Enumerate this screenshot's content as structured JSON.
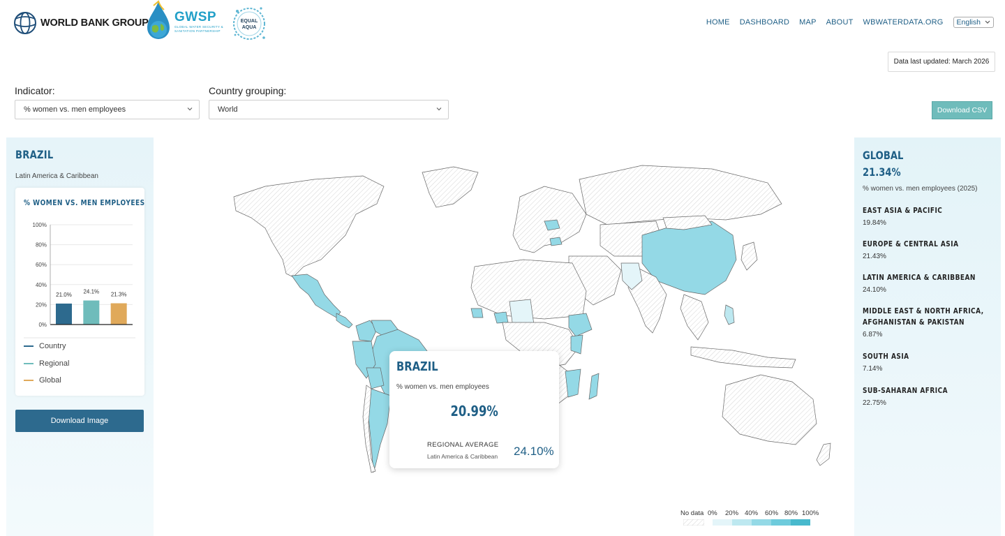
{
  "header": {
    "wb_logo_text": "WORLD BANK GROUP",
    "gwsp_title": "GWSP",
    "gwsp_subtitle": "GLOBAL WATER SECURITY & SANITATION PARTNERSHIP",
    "equal_aqua_text": "EQUAL AQUA",
    "nav": [
      "HOME",
      "DASHBOARD",
      "MAP",
      "ABOUT",
      "WBWATERDATA.ORG"
    ],
    "language": "English",
    "data_updated": "Data last updated: March 2026"
  },
  "controls": {
    "indicator_label": "Indicator:",
    "indicator_value": "% women vs. men employees",
    "grouping_label": "Country grouping:",
    "grouping_value": "World",
    "download_csv": "Download CSV"
  },
  "left": {
    "country": "BRAZIL",
    "region": "Latin America & Caribbean",
    "chart_title": "% WOMEN VS. MEN EMPLOYEES",
    "legend": [
      {
        "label": "Country",
        "color": "#2d6a8e"
      },
      {
        "label": "Regional",
        "color": "#6fbcbb"
      },
      {
        "label": "Global",
        "color": "#e0a95a"
      }
    ],
    "download_image": "Download Image"
  },
  "chart_data": {
    "type": "bar",
    "categories": [
      "Country",
      "Regional",
      "Global"
    ],
    "values": [
      21.0,
      24.1,
      21.3
    ],
    "data_labels": [
      "21.0%",
      "24.1%",
      "21.3%"
    ],
    "colors": [
      "#2d6a8e",
      "#6fbcbb",
      "#e0a95a"
    ],
    "yticks": [
      "0%",
      "20%",
      "40%",
      "60%",
      "80%",
      "100%"
    ],
    "ylim": [
      0,
      100
    ],
    "title": "% WOMEN VS. MEN EMPLOYEES"
  },
  "right": {
    "title": "GLOBAL",
    "value": "21.34%",
    "indicator": "% women vs. men employees (2025)",
    "regions": [
      {
        "name": "EAST ASIA & PACIFIC",
        "value": "19.84%"
      },
      {
        "name": "EUROPE & CENTRAL ASIA",
        "value": "21.43%"
      },
      {
        "name": "LATIN AMERICA & CARIBBEAN",
        "value": "24.10%"
      },
      {
        "name": "MIDDLE EAST & NORTH AFRICA,",
        "name2": "AFGHANISTAN & PAKISTAN",
        "value": "6.87%"
      },
      {
        "name": "SOUTH ASIA",
        "value": "7.14%"
      },
      {
        "name": "SUB-SAHARAN AFRICA",
        "value": "22.75%"
      }
    ]
  },
  "tooltip": {
    "country": "BRAZIL",
    "indicator": "% women vs. men employees",
    "value": "20.99%",
    "regional_label": "REGIONAL AVERAGE",
    "regional_sub": "Latin America & Caribbean",
    "regional_value": "24.10%"
  },
  "map_legend": {
    "no_data": "No data",
    "ticks": [
      "0%",
      "20%",
      "40%",
      "60%",
      "80%",
      "100%"
    ],
    "colors": [
      "#e4f5f9",
      "#bde8f0",
      "#94d9e6",
      "#6ecbdc",
      "#48b9cd"
    ]
  }
}
